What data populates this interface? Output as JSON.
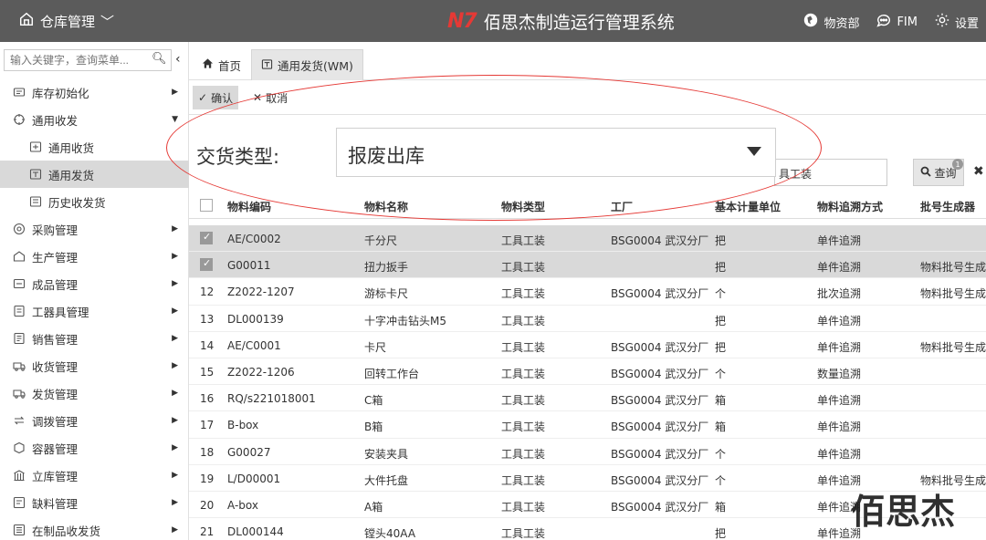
{
  "topbar": {
    "module": "仓库管理",
    "logo": "N7",
    "system_title": "佰思杰制造运行管理系统",
    "links": [
      "物资部",
      "FIM",
      "设置"
    ]
  },
  "sidebar": {
    "search_placeholder": "输入关键字，查询菜单...",
    "items": [
      {
        "label": "库存初始化",
        "icon": "inventory-icon"
      },
      {
        "label": "通用收发",
        "icon": "target-icon"
      },
      {
        "label": "通用收货",
        "icon": "receive-icon"
      },
      {
        "label": "通用发货",
        "icon": "send-icon"
      },
      {
        "label": "历史收发货",
        "icon": "history-icon"
      },
      {
        "label": "采购管理",
        "icon": "purchase-icon"
      },
      {
        "label": "生产管理",
        "icon": "production-icon"
      },
      {
        "label": "成品管理",
        "icon": "product-icon"
      },
      {
        "label": "工器具管理",
        "icon": "tool-icon"
      },
      {
        "label": "销售管理",
        "icon": "sales-icon"
      },
      {
        "label": "收货管理",
        "icon": "truck-icon"
      },
      {
        "label": "发货管理",
        "icon": "shipping-icon"
      },
      {
        "label": "调拨管理",
        "icon": "transfer-icon"
      },
      {
        "label": "容器管理",
        "icon": "container-icon"
      },
      {
        "label": "立库管理",
        "icon": "warehouse-icon"
      },
      {
        "label": "缺料管理",
        "icon": "shortage-icon"
      },
      {
        "label": "在制品收发货",
        "icon": "wip-icon"
      }
    ]
  },
  "tabs": [
    {
      "label": "首页"
    },
    {
      "label": "通用发货(WM)"
    }
  ],
  "toolbar": {
    "confirm": "确认",
    "cancel": "取消"
  },
  "filter": {
    "field_text": "具工装",
    "query": "查询",
    "badge": "1"
  },
  "delivery": {
    "label": "交货类型:",
    "value": "报废出库"
  },
  "table": {
    "columns": [
      "物料编码",
      "物料名称",
      "物料类型",
      "工厂",
      "基本计量单位",
      "物料追溯方式",
      "批号生成器"
    ],
    "rows": [
      {
        "num": "",
        "checked": true,
        "code": "AE/C0002",
        "name": "千分尺",
        "type": "工具工装",
        "plant": "BSG0004 武汉分厂",
        "unit": "把",
        "trace": "单件追溯",
        "batch": ""
      },
      {
        "num": "",
        "checked": true,
        "code": "G00011",
        "name": "扭力扳手",
        "type": "工具工装",
        "plant": "",
        "unit": "把",
        "trace": "单件追溯",
        "batch": "物料批号生成"
      },
      {
        "num": "12",
        "checked": false,
        "code": "Z2022-1207",
        "name": "游标卡尺",
        "type": "工具工装",
        "plant": "BSG0004 武汉分厂",
        "unit": "个",
        "trace": "批次追溯",
        "batch": "物料批号生成"
      },
      {
        "num": "13",
        "checked": false,
        "code": "DL000139",
        "name": "十字冲击钻头M5",
        "type": "工具工装",
        "plant": "",
        "unit": "把",
        "trace": "单件追溯",
        "batch": ""
      },
      {
        "num": "14",
        "checked": false,
        "code": "AE/C0001",
        "name": "卡尺",
        "type": "工具工装",
        "plant": "BSG0004 武汉分厂",
        "unit": "把",
        "trace": "单件追溯",
        "batch": "物料批号生成"
      },
      {
        "num": "15",
        "checked": false,
        "code": "Z2022-1206",
        "name": "回转工作台",
        "type": "工具工装",
        "plant": "BSG0004 武汉分厂",
        "unit": "个",
        "trace": "数量追溯",
        "batch": ""
      },
      {
        "num": "16",
        "checked": false,
        "code": "RQ/s221018001",
        "name": "C箱",
        "type": "工具工装",
        "plant": "BSG0004 武汉分厂",
        "unit": "箱",
        "trace": "单件追溯",
        "batch": ""
      },
      {
        "num": "17",
        "checked": false,
        "code": "B-box",
        "name": "B箱",
        "type": "工具工装",
        "plant": "BSG0004 武汉分厂",
        "unit": "箱",
        "trace": "单件追溯",
        "batch": ""
      },
      {
        "num": "18",
        "checked": false,
        "code": "G00027",
        "name": "安装夹具",
        "type": "工具工装",
        "plant": "BSG0004 武汉分厂",
        "unit": "个",
        "trace": "单件追溯",
        "batch": ""
      },
      {
        "num": "19",
        "checked": false,
        "code": "L/D00001",
        "name": "大件托盘",
        "type": "工具工装",
        "plant": "BSG0004 武汉分厂",
        "unit": "个",
        "trace": "单件追溯",
        "batch": "物料批号生成"
      },
      {
        "num": "20",
        "checked": false,
        "code": "A-box",
        "name": "A箱",
        "type": "工具工装",
        "plant": "BSG0004 武汉分厂",
        "unit": "箱",
        "trace": "单件追溯",
        "batch": ""
      },
      {
        "num": "21",
        "checked": false,
        "code": "DL000144",
        "name": "镗头40AA",
        "type": "工具工装",
        "plant": "",
        "unit": "把",
        "trace": "单件追溯",
        "batch": ""
      }
    ]
  },
  "watermark": "佰思杰",
  "colors": {
    "topbar": "#5b5b5b",
    "logo": "#e53935",
    "highlight_oval": "#e53935",
    "selected_row": "#d9d9d9"
  }
}
